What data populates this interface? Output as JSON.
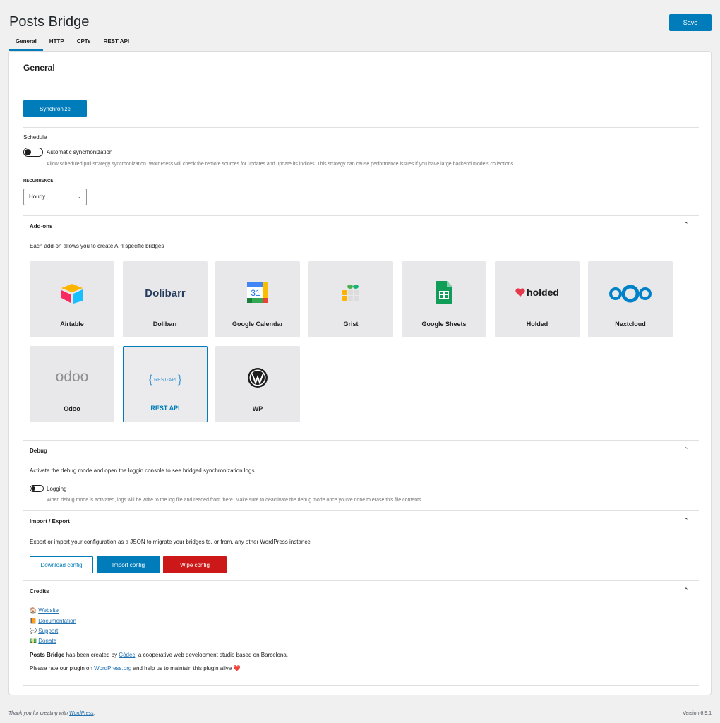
{
  "app_title": "Posts Bridge",
  "save_label": "Save",
  "tabs": [
    {
      "label": "General"
    },
    {
      "label": "HTTP"
    },
    {
      "label": "CPTs"
    },
    {
      "label": "REST API"
    }
  ],
  "panel_title": "General",
  "sync_label": "Synchronize",
  "schedule": {
    "heading": "Schedule",
    "toggle_label": "Automatic syncrhonization",
    "help": "Allow scheduled pull strategy syncrhonization. WordPress will check the remote sources for updates and update its indices. This strategy can cause performance issues if you have large backend models collections",
    "recurrence_label": "RECURRENCE",
    "recurrence_value": "Hourly"
  },
  "addons": {
    "title": "Add-ons",
    "description": "Each add-on allows you to create API specific bridges",
    "items": [
      {
        "label": "Airtable"
      },
      {
        "label": "Dolibarr"
      },
      {
        "label": "Google Calendar"
      },
      {
        "label": "Grist"
      },
      {
        "label": "Google Sheets"
      },
      {
        "label": "Holded"
      },
      {
        "label": "Nextcloud"
      },
      {
        "label": "Odoo"
      },
      {
        "label": "REST API"
      },
      {
        "label": "WP"
      }
    ],
    "logo_text": {
      "dolibarr": "Dolibarr",
      "calendar_day": "31",
      "holded": "holded",
      "odoo": "odoo",
      "rest": "REST-API"
    }
  },
  "debug": {
    "title": "Debug",
    "description": "Activate the debug mode and open the loggin console to see bridged synchronization logs",
    "toggle_label": "Logging",
    "help": "When debug mode is activated, logs will be write to the log file and readed from there. Make sure to deactivate the debug mode once you've done to erase this file contents."
  },
  "import_export": {
    "title": "Import / Export",
    "description": "Export or import your configuration as a JSON to migrate your bridges to, or from, any other WordPress instance",
    "download_label": "Download config",
    "import_label": "Import config",
    "wipe_label": "Wipe config"
  },
  "credits": {
    "title": "Credits",
    "links": [
      {
        "emoji": "🏠",
        "label": "Website"
      },
      {
        "emoji": "📙",
        "label": "Documentation"
      },
      {
        "emoji": "💬",
        "label": "Support"
      },
      {
        "emoji": "💵",
        "label": "Donate"
      }
    ],
    "created_by_name": "Posts Bridge",
    "created_by_mid": " has been created by ",
    "created_by_link": "Còdec",
    "created_by_tail": ", a cooperative web development studio based on Barcelona.",
    "rate_head": "Please rate our plugin on ",
    "rate_link": "WordPress.org",
    "rate_tail": " and help us to maintain this plugin alive ❤️"
  },
  "footer": {
    "thanks_head": "Thank you for creating with ",
    "thanks_link": "WordPress",
    "thanks_tail": ".",
    "version": "Version 6.9.1"
  }
}
